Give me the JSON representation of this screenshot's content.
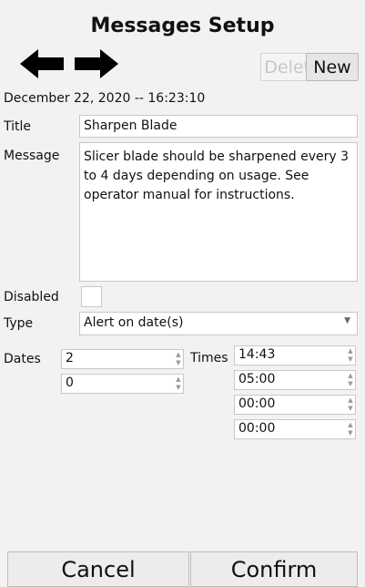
{
  "header": {
    "title": "Messages Setup"
  },
  "toolbar": {
    "delete_label": "Delete",
    "new_label": "New"
  },
  "datetime": "December 22, 2020 -- 16:23:10",
  "form": {
    "title_label": "Title",
    "title_value": "Sharpen Blade",
    "message_label": "Message",
    "message_value": "Slicer blade should be sharpened every 3 to 4 days depending on usage. See operator manual for instructions.",
    "disabled_label": "Disabled",
    "type_label": "Type",
    "type_value": "Alert on date(s)",
    "dates_label": "Dates",
    "dates": [
      "2",
      "0"
    ],
    "times_label": "Times",
    "times": [
      "14:43",
      "05:00",
      "00:00",
      "00:00"
    ]
  },
  "footer": {
    "cancel_label": "Cancel",
    "confirm_label": "Confirm"
  },
  "icons": {
    "back": "arrow-left-icon",
    "forward": "arrow-right-icon"
  }
}
